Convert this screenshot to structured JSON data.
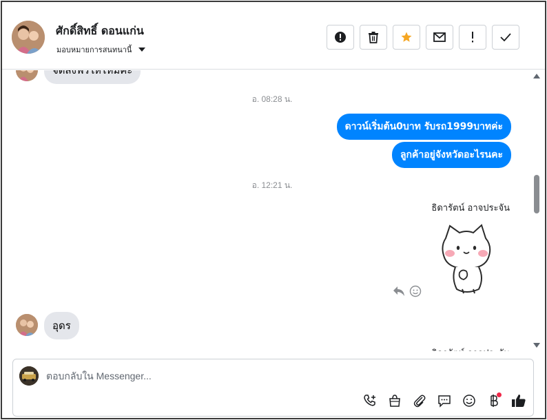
{
  "header": {
    "contact_name": "ศักดิ์สิทธิ์ ดอนแก่น",
    "assign_label": "มอบหมายการสนทนานี้",
    "actions": [
      {
        "name": "spam-button",
        "icon": "alert-circle-icon"
      },
      {
        "name": "delete-button",
        "icon": "trash-icon"
      },
      {
        "name": "star-button",
        "icon": "star-icon"
      },
      {
        "name": "mark-unread-button",
        "icon": "envelope-icon"
      },
      {
        "name": "follow-up-button",
        "icon": "exclamation-icon"
      },
      {
        "name": "done-button",
        "icon": "check-icon"
      }
    ]
  },
  "thread": {
    "top_partial_message": "จัดส่งฟรีให้ไหมคะ",
    "timestamp1": "อ. 08:28 น.",
    "outgoing1": "ดาวน์เริ่มต้น0บาท รับรถ1999บาทค่ะ",
    "outgoing2": "ลูกค้าอยู่จังหวัดอะไรนคะ",
    "timestamp2": "อ. 12:21 น.",
    "sender_name": "ธิดารัตน์ อาจประจัน",
    "sticker": "cat-sticker",
    "incoming": "อุดร",
    "bottom_sender_partial": "ธิดารัตน์ อาจประจัน"
  },
  "composer": {
    "placeholder": "ตอบกลับใน Messenger...",
    "tools": [
      "call-add-icon",
      "shop-bag-icon",
      "paperclip-icon",
      "saved-reply-icon",
      "emoji-icon",
      "baht-icon",
      "like-icon"
    ]
  },
  "colors": {
    "accent": "#0084ff",
    "star": "#f5a623",
    "incoming_bubble": "#e4e6eb"
  }
}
